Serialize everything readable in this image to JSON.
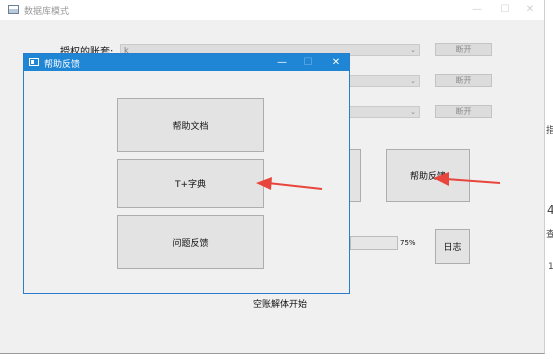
{
  "main_window": {
    "title": "数据库模式",
    "label_user_credentials": "授权的账套:",
    "combo_1_value": "k",
    "disconnect_label": "断开",
    "help_feedback_label": "帮助反馈",
    "log_label": "日志",
    "progress_value": 0.75,
    "progress_text": "75%",
    "status_text": "空账解体开始"
  },
  "dialog": {
    "title": "帮助反馈",
    "buttons": {
      "help_docs": "帮助文档",
      "t_dict": "T+字典",
      "issue_feedback": "问题反馈"
    }
  },
  "window_controls": {
    "minimize": "—",
    "maximize": "☐",
    "close": "✕"
  },
  "edge_fragments": {
    "f1": "4",
    "f2": "查",
    "f3": "指",
    "f4": "1"
  },
  "colors": {
    "dialog_accent": "#1f86d6",
    "arrow": "#e8453c"
  }
}
